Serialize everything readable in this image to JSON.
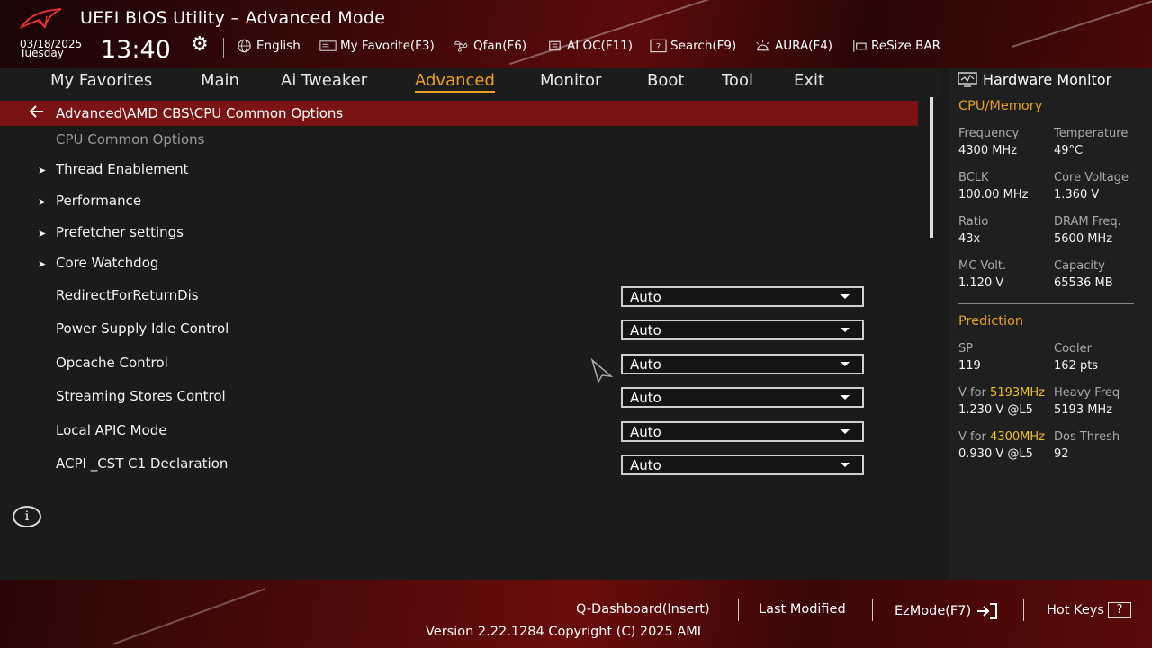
{
  "header": {
    "title": "UEFI BIOS Utility – Advanced Mode",
    "date": "03/18/2025",
    "day": "Tuesday",
    "time": "13:40",
    "toolbar": [
      {
        "label": "English",
        "icon": "globe-icon"
      },
      {
        "label": "My Favorite(F3)",
        "icon": "favorite-icon"
      },
      {
        "label": "Qfan(F6)",
        "icon": "fan-icon"
      },
      {
        "label": "AI OC(F11)",
        "icon": "ai-chip-icon"
      },
      {
        "label": "Search(F9)",
        "icon": "search-icon"
      },
      {
        "label": "AURA(F4)",
        "icon": "aura-light-icon"
      },
      {
        "label": "ReSize BAR",
        "icon": "resize-bar-icon"
      }
    ]
  },
  "tabs": [
    "My Favorites",
    "Main",
    "Ai Tweaker",
    "Advanced",
    "Monitor",
    "Boot",
    "Tool",
    "Exit"
  ],
  "active_tab": "Advanced",
  "main": {
    "breadcrumb": "Advanced\\AMD CBS\\CPU Common Options",
    "subheading": "CPU Common Options",
    "submenus": [
      "Thread Enablement",
      "Performance",
      "Prefetcher settings",
      "Core Watchdog"
    ],
    "settings": [
      {
        "label": "RedirectForReturnDis",
        "value": "Auto"
      },
      {
        "label": "Power Supply Idle Control",
        "value": "Auto"
      },
      {
        "label": "Opcache Control",
        "value": "Auto"
      },
      {
        "label": "Streaming Stores Control",
        "value": "Auto"
      },
      {
        "label": "Local APIC Mode",
        "value": "Auto"
      },
      {
        "label": "ACPI _CST C1 Declaration",
        "value": "Auto"
      }
    ]
  },
  "hw_monitor": {
    "title": "Hardware Monitor",
    "cpu_memory": {
      "title": "CPU/Memory",
      "items": [
        {
          "label": "Frequency",
          "value": "4300 MHz"
        },
        {
          "label": "Temperature",
          "value": "49°C"
        },
        {
          "label": "BCLK",
          "value": "100.00 MHz"
        },
        {
          "label": "Core Voltage",
          "value": "1.360 V"
        },
        {
          "label": "Ratio",
          "value": "43x"
        },
        {
          "label": "DRAM Freq.",
          "value": "5600 MHz"
        },
        {
          "label": "MC Volt.",
          "value": "1.120 V"
        },
        {
          "label": "Capacity",
          "value": "65536 MB"
        }
      ]
    },
    "prediction": {
      "title": "Prediction",
      "sp_label": "SP",
      "sp_value": "119",
      "cooler_label": "Cooler",
      "cooler_value": "162 pts",
      "v1_prefix": "V for ",
      "v1_freq": "5193MHz",
      "v1_value": "1.230 V @L5",
      "heavy_label": "Heavy Freq",
      "heavy_value": "5193 MHz",
      "v2_prefix": "V for ",
      "v2_freq": "4300MHz",
      "v2_value": "0.930 V @L5",
      "dos_label": "Dos Thresh",
      "dos_value": "92"
    }
  },
  "footer": {
    "qdashboard": "Q-Dashboard(Insert)",
    "last_modified": "Last Modified",
    "ezmode": "EzMode(F7)",
    "hotkeys": "Hot Keys",
    "hotkeys_key": "?",
    "version": "Version 2.22.1284 Copyright (C) 2025 AMI"
  },
  "colors": {
    "accent": "#f0a020",
    "breadcrumb_bg": "#7a1414",
    "highlight": "#f0c020"
  }
}
